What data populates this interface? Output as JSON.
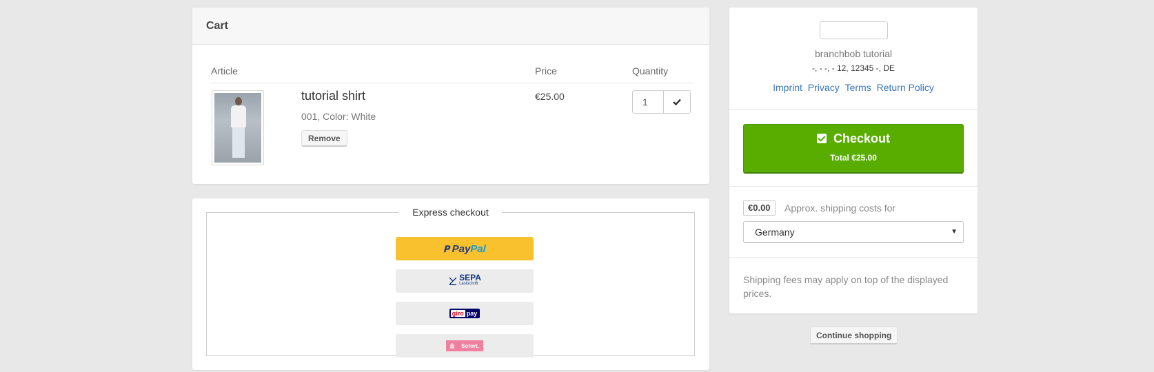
{
  "cart": {
    "title": "Cart",
    "columns": {
      "article": "Article",
      "price": "Price",
      "quantity": "Quantity"
    },
    "items": [
      {
        "name": "tutorial shirt",
        "variant": "001, Color: White",
        "remove_label": "Remove",
        "price": "€25.00",
        "quantity": "1"
      }
    ]
  },
  "express": {
    "legend": "Express checkout",
    "methods": [
      {
        "name": "PayPal",
        "pay": "Pay",
        "pal": "Pal",
        "color": "#f8c12d"
      },
      {
        "name": "SEPA",
        "label": "SEPA",
        "sublabel": "Lastschrift"
      },
      {
        "name": "giropay",
        "giro": "giro",
        "pay": "pay"
      },
      {
        "name": "Sofort",
        "label": "Sofort."
      }
    ]
  },
  "shop": {
    "name": "branchbob tutorial",
    "address": "-, - -, - 12, 12345 -, DE",
    "links": [
      "Imprint",
      "Privacy",
      "Terms",
      "Return Policy"
    ]
  },
  "checkout": {
    "label": "Checkout",
    "total": "Total €25.00",
    "color": "#58ad00"
  },
  "shipping": {
    "cost": "€0.00",
    "label": "Approx. shipping costs for",
    "country": "Germany",
    "note": "Shipping fees may apply on top of the displayed prices."
  },
  "continue_label": "Continue shopping"
}
